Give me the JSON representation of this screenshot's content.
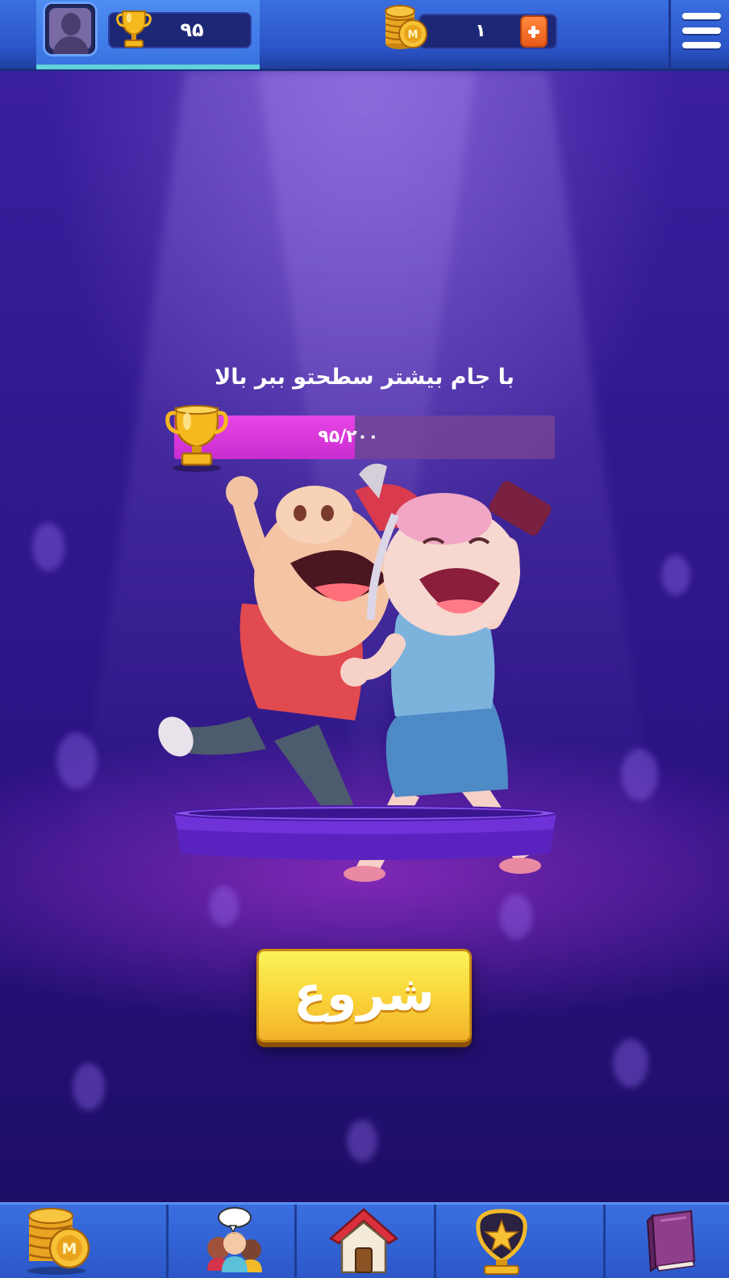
{
  "header": {
    "trophy_count": "۹۵",
    "coin_count": "۱",
    "icons": [
      "avatar-icon",
      "trophy-icon",
      "coins-icon",
      "plus-icon",
      "menu-icon"
    ]
  },
  "main": {
    "headline": "با جام بیشتر سطحتو ببر بالا",
    "progress": {
      "text": "۹۵/۲۰۰",
      "current": 95,
      "total": 200
    },
    "start_label": "شروع"
  },
  "bottom_nav": {
    "items": [
      "coins-icon",
      "friends-icon",
      "home-icon",
      "star-badge-icon",
      "book-icon"
    ]
  },
  "colors": {
    "accent_blue": "#2b57c9",
    "progress_fill": "#d93bd9",
    "start_button": "#f7d33a",
    "stage_bg": "#2f168a"
  }
}
